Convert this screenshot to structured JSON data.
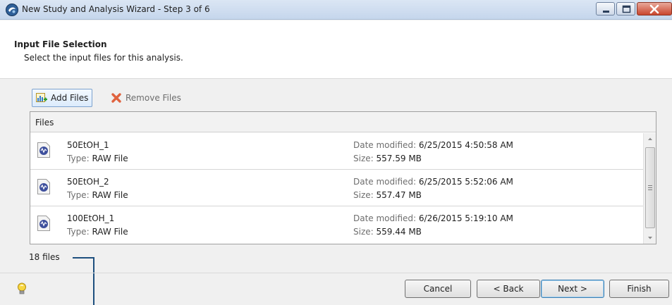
{
  "window": {
    "title": "New Study and Analysis Wizard - Step 3 of 6",
    "app_icon": "app-logo-icon",
    "controls": {
      "minimize": "minimize-icon",
      "maximize": "maximize-icon",
      "close": "close-icon"
    }
  },
  "header": {
    "title": "Input File Selection",
    "description": "Select the input files for this analysis."
  },
  "toolbar": {
    "add_label": "Add Files",
    "add_icon": "add-files-icon",
    "remove_label": "Remove Files",
    "remove_icon": "remove-x-icon"
  },
  "file_list": {
    "column_header": "Files",
    "date_label": "Date modified:",
    "size_label": "Size:",
    "type_label": "Type:",
    "file_icon": "raw-file-icon",
    "rows": [
      {
        "name": "50EtOH_1",
        "type": "RAW File",
        "date": "6/25/2015 4:50:58 AM",
        "size": "557.59 MB"
      },
      {
        "name": "50EtOH_2",
        "type": "RAW File",
        "date": "6/25/2015 5:52:06 AM",
        "size": "557.47 MB"
      },
      {
        "name": "100EtOH_1",
        "type": "RAW File",
        "date": "6/26/2015 5:19:10 AM",
        "size": "559.44 MB"
      }
    ]
  },
  "status": {
    "file_count": "18 files"
  },
  "footer": {
    "hint_icon": "lightbulb-icon",
    "cancel": "Cancel",
    "back": "< Back",
    "next": "Next >",
    "finish": "Finish"
  },
  "colors": {
    "titlebar": "#c5d6ec",
    "close_button": "#c9452d",
    "callout_line": "#1d4f7e",
    "default_button_border": "#3c7fb1"
  }
}
